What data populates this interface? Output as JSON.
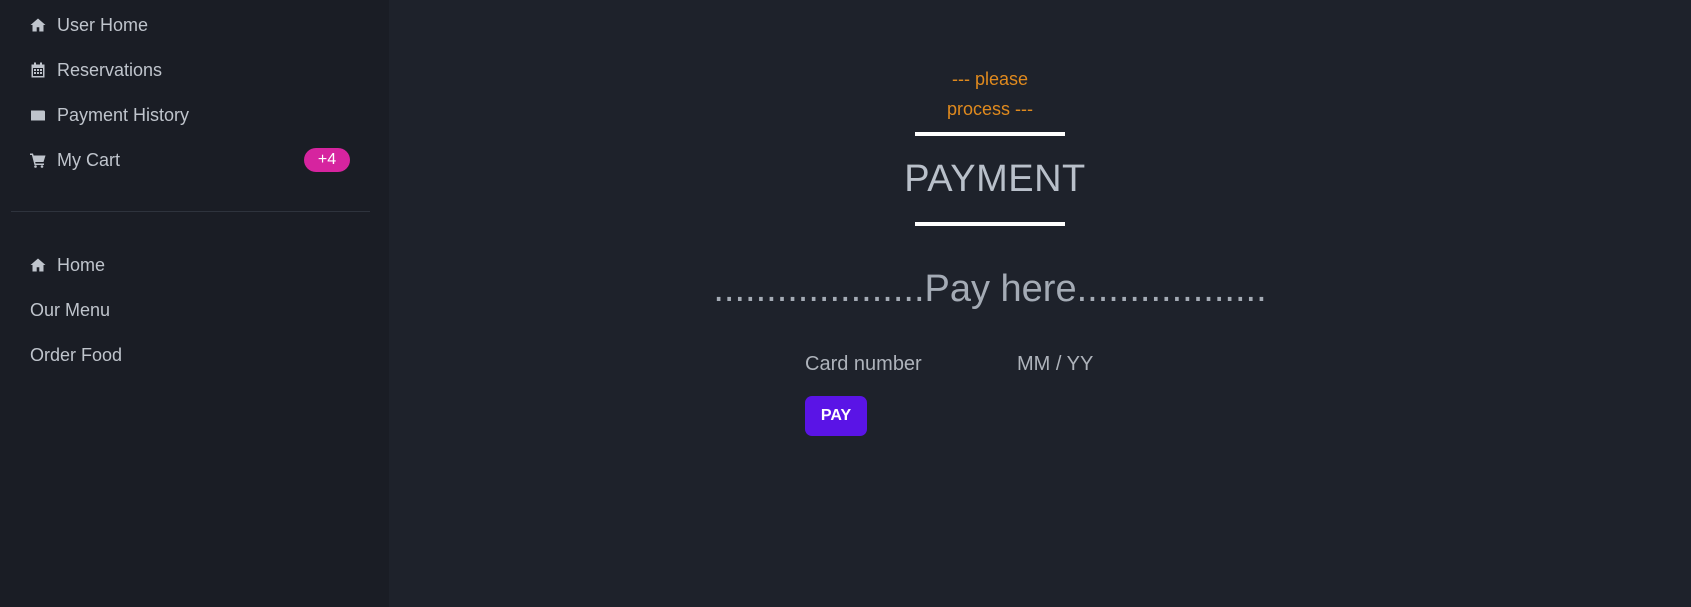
{
  "sidebar": {
    "user_items": [
      {
        "label": "User Home",
        "icon": "home-icon"
      },
      {
        "label": "Reservations",
        "icon": "calendar-icon"
      },
      {
        "label": "Payment History",
        "icon": "wallet-icon"
      },
      {
        "label": "My Cart",
        "icon": "cart-icon"
      }
    ],
    "cart_badge": "+4",
    "site_items": [
      {
        "label": "Home",
        "icon": "home-icon"
      },
      {
        "label": "Our Menu"
      },
      {
        "label": "Order Food"
      }
    ]
  },
  "main": {
    "subtitle_line1": "--- please",
    "subtitle_line2": "process ---",
    "title": "PAYMENT",
    "pay_here": "....................Pay here..................",
    "card_number_placeholder": "Card number",
    "expiry_placeholder": "MM / YY",
    "pay_button": "PAY"
  },
  "colors": {
    "background": "#1e222b",
    "sidebar": "#1a1d25",
    "accent_orange": "#e08a1e",
    "badge": "#d6249f",
    "button": "#5a14e6"
  }
}
